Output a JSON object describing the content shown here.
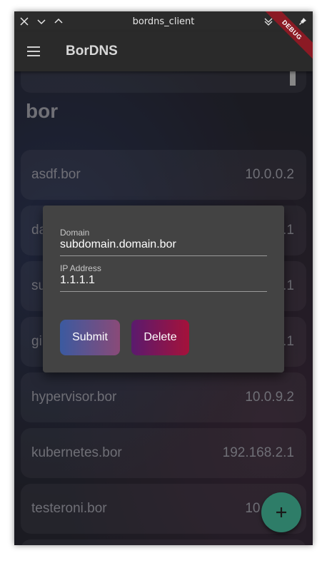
{
  "window": {
    "title": "bordns_client"
  },
  "appbar": {
    "title": "BorDNS",
    "debug_label": "DEBUG",
    "menu_icon": "hamburger-menu-icon"
  },
  "section": {
    "title": "bor"
  },
  "records": [
    {
      "name": "asdf.bor",
      "ip": "10.0.0.2"
    },
    {
      "name": "da",
      "ip": ".1"
    },
    {
      "name": "su",
      "ip": ".1"
    },
    {
      "name": "gi",
      "ip": ".1"
    },
    {
      "name": "hypervisor.bor",
      "ip": "10.0.9.2"
    },
    {
      "name": "kubernetes.bor",
      "ip": "192.168.2.1"
    },
    {
      "name": "testeroni.bor",
      "ip": "10.0.0.1"
    }
  ],
  "dialog": {
    "domain_label": "Domain",
    "domain_value": "subdomain.domain.bor",
    "ip_label": "IP Address",
    "ip_value": "1.1.1.1",
    "submit_label": "Submit",
    "delete_label": "Delete"
  },
  "fab": {
    "icon": "plus-icon"
  }
}
